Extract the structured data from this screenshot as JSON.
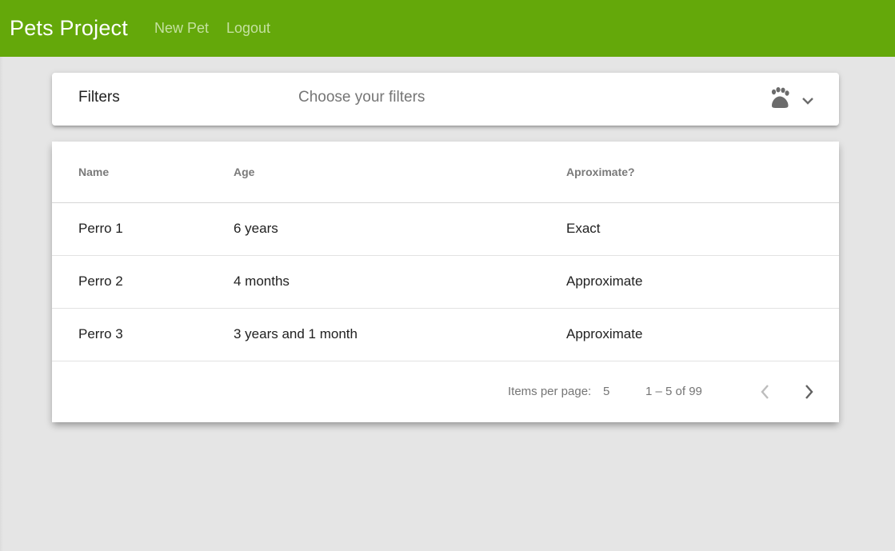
{
  "app": {
    "title": "Pets Project",
    "nav": [
      "New Pet",
      "Logout"
    ],
    "primary_color": "#64a80a"
  },
  "filters": {
    "title": "Filters",
    "description": "Choose your filters",
    "icons": [
      "paw-icon",
      "chevron-down-icon"
    ]
  },
  "table": {
    "columns": [
      "Name",
      "Age",
      "Aproximate?"
    ],
    "rows": [
      [
        "Perro 1",
        "6 years",
        "Exact"
      ],
      [
        "Perro 2",
        "4 months",
        "Approximate"
      ],
      [
        "Perro 3",
        "3 years and 1 month",
        "Approximate"
      ]
    ]
  },
  "paginator": {
    "items_per_page_label": "Items per page:",
    "items_per_page": "5",
    "range_label": "1 – 5 of 99",
    "icons": [
      "chevron-left-icon",
      "chevron-right-icon"
    ]
  }
}
